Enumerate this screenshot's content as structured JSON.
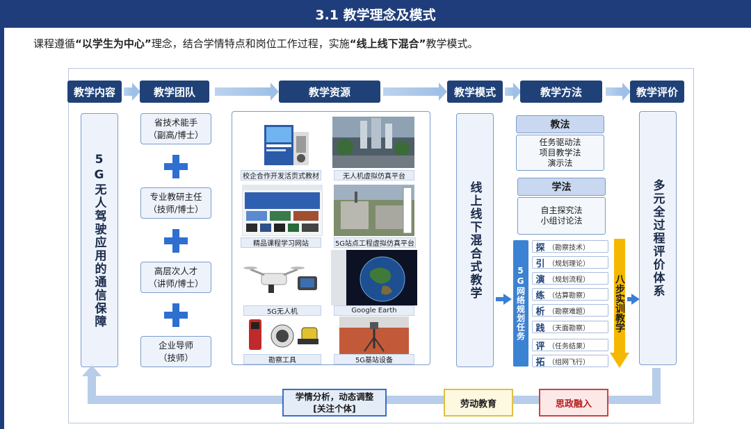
{
  "title": "3.1 教学理念及模式",
  "intro": {
    "p1": "课程遵循",
    "b1": "“以学生为中心”",
    "p2": "理念，结合学情特点和岗位工作过程，实施",
    "b2": "“线上线下混合”",
    "p3": "教学模式。"
  },
  "headers": {
    "content": "教学内容",
    "team": "教学团队",
    "resources": "教学资源",
    "mode": "教学模式",
    "method": "教学方法",
    "evaluation": "教学评价"
  },
  "content_box": "5G无人驾驶应用的通信保障",
  "team": [
    {
      "line1": "省技术能手",
      "line2": "（副高/博士）"
    },
    {
      "line1": "专业教研主任",
      "line2": "（技师/博士）"
    },
    {
      "line1": "高层次人才",
      "line2": "（讲师/博士）"
    },
    {
      "line1": "企业导师",
      "line2": "（技师）"
    }
  ],
  "resources": [
    "校企合作开发活页式教材",
    "无人机虚拟仿真平台",
    "精品课程学习网站",
    "5G站点工程虚拟仿真平台",
    "5G无人机",
    "Google Earth",
    "勘察工具",
    "5G基站设备"
  ],
  "mode_box": "线上线下混合式教学",
  "methods": {
    "teach_title": "教法",
    "teach_items": [
      "任务驱动法",
      "项目教学法",
      "演示法"
    ],
    "learn_title": "学法",
    "learn_items": [
      "自主探究法",
      "小组讨论法"
    ]
  },
  "task_stripe": "5G网络规划任务",
  "steps": [
    {
      "char": "探",
      "desc": "（勘察技术）"
    },
    {
      "char": "引",
      "desc": "（规划理论）"
    },
    {
      "char": "演",
      "desc": "（规划流程）"
    },
    {
      "char": "练",
      "desc": "（估算勘察）"
    },
    {
      "char": "析",
      "desc": "（勘察难题）"
    },
    {
      "char": "践",
      "desc": "（天面勘察）"
    },
    {
      "char": "评",
      "desc": "（任务结果）"
    },
    {
      "char": "拓",
      "desc": "（组网飞行）"
    }
  ],
  "eight_step": "八步实训教学",
  "evaluation_box": "多元全过程评价体系",
  "bottom": {
    "analysis_line1": "学情分析，动态调整",
    "analysis_line2": "[关注个体]",
    "labor": "劳动教育",
    "ideology": "思政融入"
  },
  "colors": {
    "header_bg": "#1f4177",
    "title_bar": "#1f3d7a",
    "box_bg": "#eef3fb",
    "box_border": "#7a9ccb",
    "accent_blue": "#3b7fd3",
    "yellow_arrow": "#f5b800",
    "labor_border": "#e0c040",
    "ideology_border": "#d04040"
  }
}
